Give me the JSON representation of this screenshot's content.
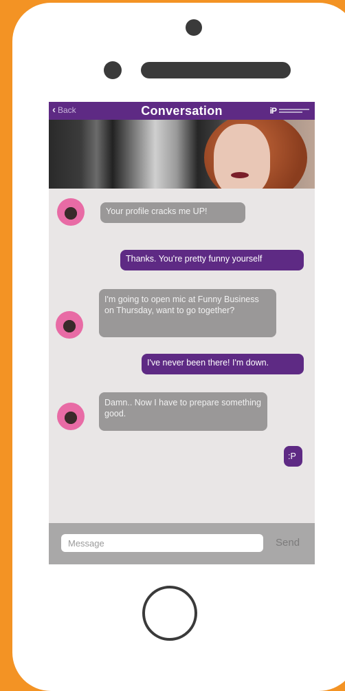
{
  "nav": {
    "back_label": "Back",
    "title": "Conversation",
    "logo_text": "iP"
  },
  "messages": [
    {
      "side": "received",
      "text": "Your profile cracks me UP!"
    },
    {
      "side": "sent",
      "text": "Thanks. You're pretty funny yourself"
    },
    {
      "side": "received",
      "text": "I'm going to open mic at Funny Business on Thursday, want to go together?"
    },
    {
      "side": "sent",
      "text": "I've never been there! I'm down."
    },
    {
      "side": "received",
      "text": "Damn.. Now I have to prepare something good."
    },
    {
      "side": "sent",
      "text": ":P"
    }
  ],
  "composer": {
    "placeholder": "Message",
    "send_label": "Send"
  },
  "colors": {
    "accent": "#5e2a84",
    "device_frame": "#f39324",
    "received_bubble": "#9a9898"
  }
}
